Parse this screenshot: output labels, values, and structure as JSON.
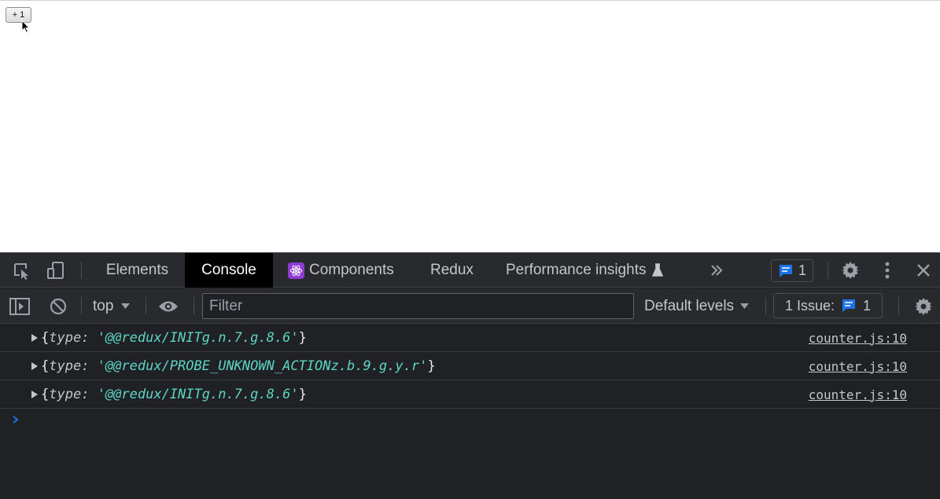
{
  "page": {
    "button_label": "+ 1"
  },
  "devtools": {
    "tabs": [
      {
        "label": "Elements",
        "active": false
      },
      {
        "label": "Console",
        "active": true
      },
      {
        "label": "Components",
        "active": false
      },
      {
        "label": "Redux",
        "active": false
      },
      {
        "label": "Performance insights",
        "active": false
      }
    ],
    "header_issue_count": "1",
    "toolbar": {
      "context": "top",
      "filter_placeholder": "Filter",
      "levels": "Default levels",
      "issues_label": "1 Issue:",
      "issues_count": "1"
    },
    "console_rows": [
      {
        "key": "type",
        "value": "'@@redux/INITg.n.7.g.8.6'",
        "source": "counter.js:10"
      },
      {
        "key": "type",
        "value": "'@@redux/PROBE_UNKNOWN_ACTIONz.b.9.g.y.r'",
        "source": "counter.js:10"
      },
      {
        "key": "type",
        "value": "'@@redux/INITg.n.7.g.8.6'",
        "source": "counter.js:10"
      }
    ],
    "colors": {
      "panel_bg": "#202124",
      "toolbar_bg": "#292a2d",
      "active_tab_bg": "#000000",
      "string_color": "#5cd5c4",
      "accent_blue": "#1a73e8",
      "react_purple": "#8e3bd6"
    }
  }
}
